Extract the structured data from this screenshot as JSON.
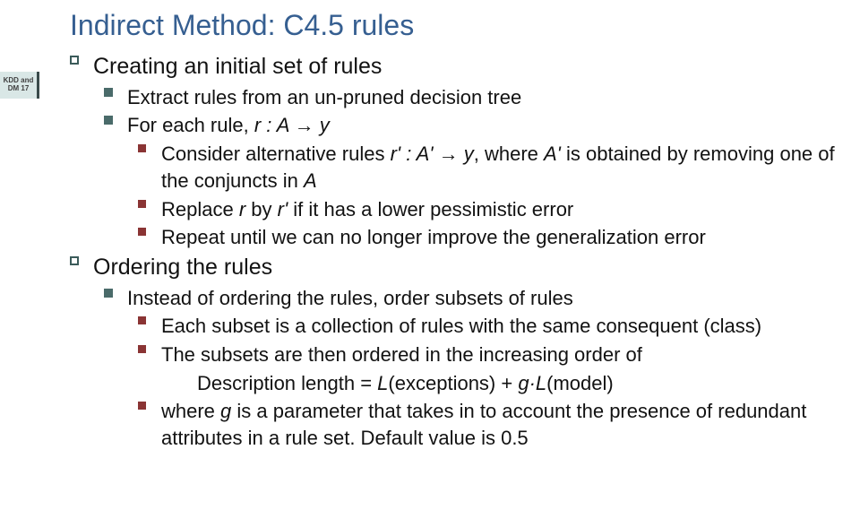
{
  "sidebar": {
    "line1": "KDD and",
    "line2": "DM 17"
  },
  "title": "Indirect Method: C4.5 rules",
  "s1": {
    "heading": "Creating an initial set of rules",
    "p1": "Extract rules from an un-pruned decision tree",
    "p2_a": "For each rule, ",
    "p2_b": "r : A → y",
    "p3_a": "Consider alternative rules ",
    "p3_b": "r' : A' → y",
    "p3_c": ", where ",
    "p3_d": "A'",
    "p3_e": " is obtained by removing one of the conjuncts in ",
    "p3_f": "A",
    "p4_a": "Replace ",
    "p4_b": "r",
    "p4_c": " by ",
    "p4_d": "r'",
    "p4_e": " if it has a lower pessimistic error",
    "p5": "Repeat until we can no longer improve the generalization error"
  },
  "s2": {
    "heading": "Ordering the rules",
    "p1": "Instead of ordering the rules, order subsets of rules",
    "p2": "Each subset is a collection of rules with the same consequent (class)",
    "p3": "The subsets are then ordered in the increasing order of",
    "p3b_a": "Description length = ",
    "p3b_b": "L",
    "p3b_c": "(exceptions) + ",
    "p3b_d": "g·L",
    "p3b_e": "(model)",
    "p4_a": "where ",
    "p4_b": "g",
    "p4_c": " is a parameter that takes in to account the presence of redundant attributes in a rule set. Default value is 0.5"
  }
}
